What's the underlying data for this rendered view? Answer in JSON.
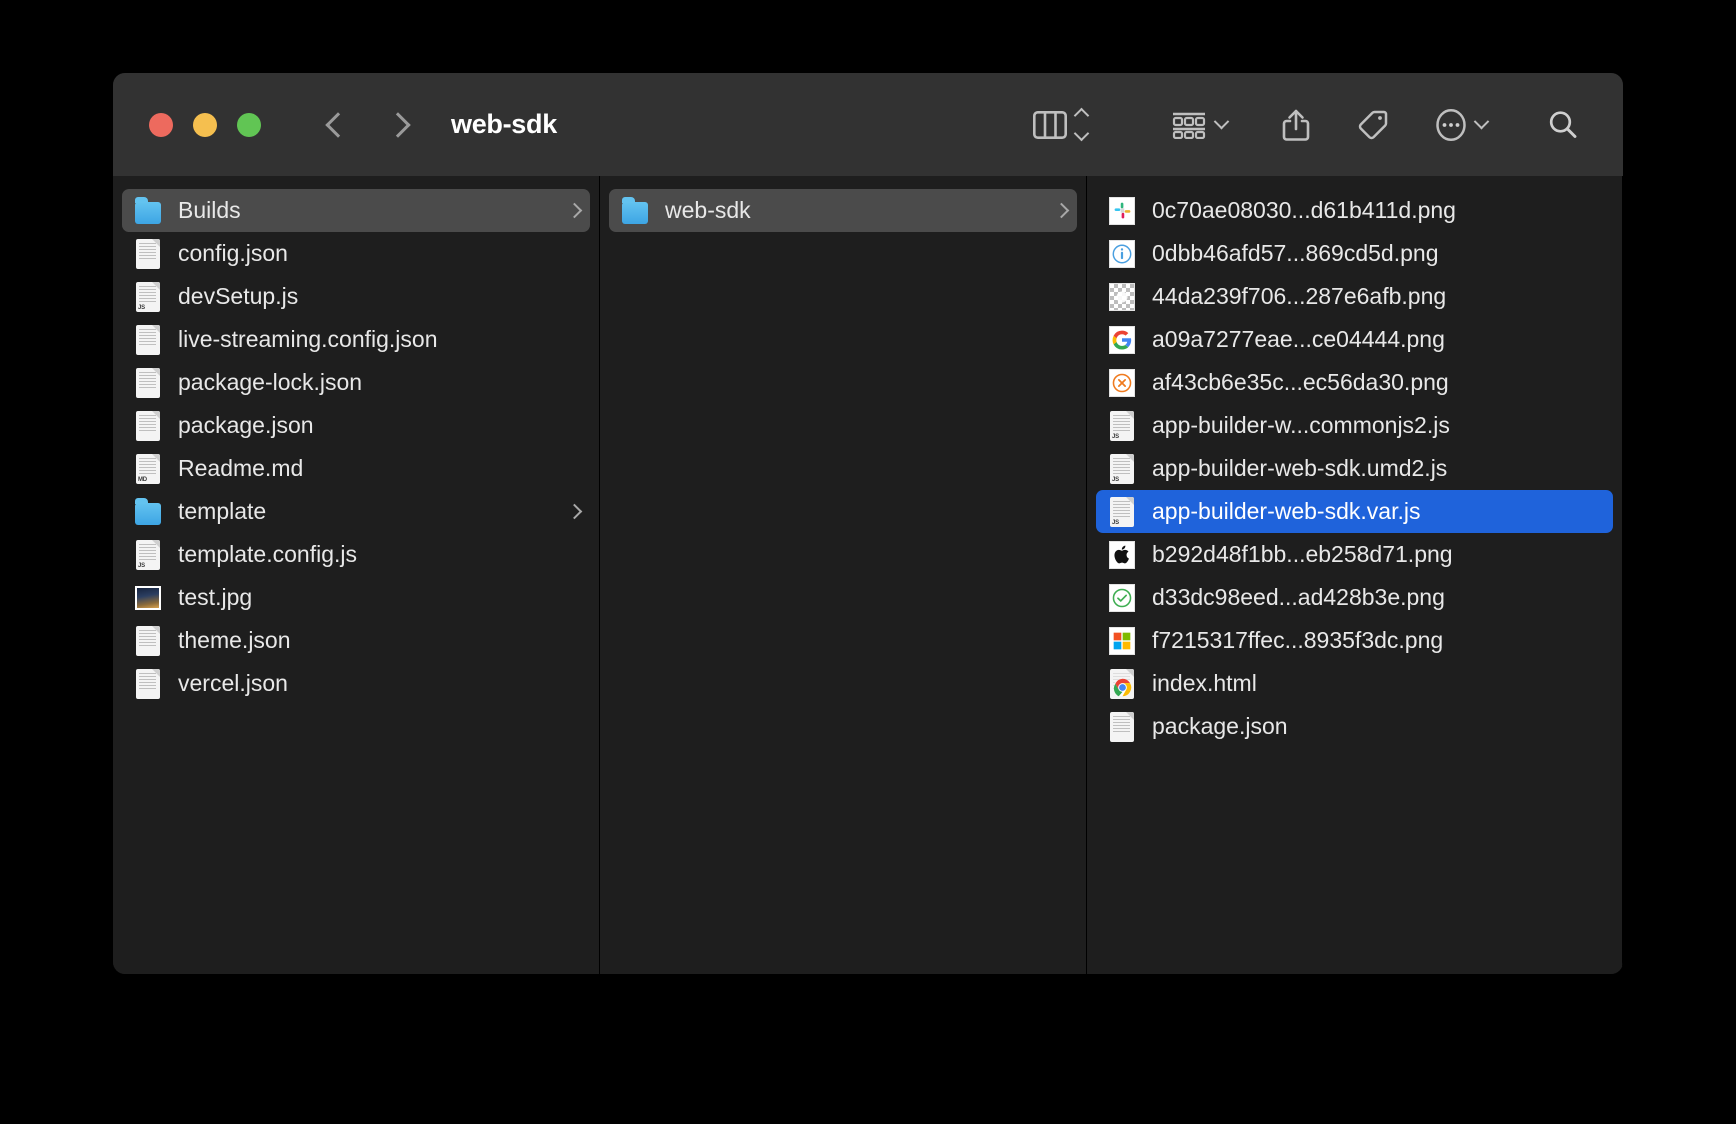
{
  "window": {
    "title": "web-sdk",
    "traffic_lights": [
      {
        "name": "close",
        "color": "#ed6a5e"
      },
      {
        "name": "minimize",
        "color": "#f5bf4f"
      },
      {
        "name": "maximize",
        "color": "#61c554"
      }
    ],
    "nav": {
      "back": "back",
      "forward": "forward"
    }
  },
  "toolbar": {
    "view_mode": "column-view",
    "sort_control": "arrange-sort",
    "group_by": "group-by",
    "share": "share",
    "tags": "tags",
    "more": "more-actions",
    "search": "search"
  },
  "colors": {
    "selection_blue": "#1f63db",
    "row_highlight": "#4b4b4b",
    "window_bg": "#1e1e1e",
    "toolbar_bg": "#323232",
    "folder_blue": "#3da5e4"
  },
  "columns": [
    {
      "name": "column-1",
      "items": [
        {
          "label": "Builds",
          "icon": "folder",
          "state": "highlighted",
          "disclosure": true
        },
        {
          "label": "config.json",
          "icon": "doc",
          "state": "normal",
          "disclosure": false
        },
        {
          "label": "devSetup.js",
          "icon": "doc-js",
          "state": "normal",
          "disclosure": false
        },
        {
          "label": "live-streaming.config.json",
          "icon": "doc",
          "state": "normal",
          "disclosure": false
        },
        {
          "label": "package-lock.json",
          "icon": "doc",
          "state": "normal",
          "disclosure": false
        },
        {
          "label": "package.json",
          "icon": "doc",
          "state": "normal",
          "disclosure": false
        },
        {
          "label": "Readme.md",
          "icon": "doc-md",
          "state": "normal",
          "disclosure": false
        },
        {
          "label": "template",
          "icon": "folder",
          "state": "normal",
          "disclosure": true
        },
        {
          "label": "template.config.js",
          "icon": "doc-js",
          "state": "normal",
          "disclosure": false
        },
        {
          "label": "test.jpg",
          "icon": "photo",
          "state": "normal",
          "disclosure": false
        },
        {
          "label": "theme.json",
          "icon": "doc",
          "state": "normal",
          "disclosure": false
        },
        {
          "label": "vercel.json",
          "icon": "doc",
          "state": "normal",
          "disclosure": false
        }
      ]
    },
    {
      "name": "column-2",
      "items": [
        {
          "label": "web-sdk",
          "icon": "folder",
          "state": "highlighted",
          "disclosure": true
        }
      ]
    },
    {
      "name": "column-3",
      "items": [
        {
          "label": "0c70ae08030...d61b411d.png",
          "icon": "thumb-slack",
          "state": "normal",
          "disclosure": false
        },
        {
          "label": "0dbb46afd57...869cd5d.png",
          "icon": "thumb-info",
          "state": "normal",
          "disclosure": false
        },
        {
          "label": "44da239f706...287e6afb.png",
          "icon": "thumb-alpha",
          "state": "normal",
          "disclosure": false
        },
        {
          "label": "a09a7277eae...ce04444.png",
          "icon": "thumb-google",
          "state": "normal",
          "disclosure": false
        },
        {
          "label": "af43cb6e35c...ec56da30.png",
          "icon": "thumb-error",
          "state": "normal",
          "disclosure": false
        },
        {
          "label": "app-builder-w...commonjs2.js",
          "icon": "doc-js",
          "state": "normal",
          "disclosure": false
        },
        {
          "label": "app-builder-web-sdk.umd2.js",
          "icon": "doc-js",
          "state": "normal",
          "disclosure": false
        },
        {
          "label": "app-builder-web-sdk.var.js",
          "icon": "doc-js",
          "state": "selected",
          "disclosure": false
        },
        {
          "label": "b292d48f1bb...eb258d71.png",
          "icon": "thumb-apple",
          "state": "normal",
          "disclosure": false
        },
        {
          "label": "d33dc98eed...ad428b3e.png",
          "icon": "thumb-check",
          "state": "normal",
          "disclosure": false
        },
        {
          "label": "f7215317ffec...8935f3dc.png",
          "icon": "thumb-microsoft",
          "state": "normal",
          "disclosure": false
        },
        {
          "label": "index.html",
          "icon": "doc-chrome",
          "state": "normal",
          "disclosure": false
        },
        {
          "label": "package.json",
          "icon": "doc",
          "state": "normal",
          "disclosure": false
        }
      ]
    }
  ]
}
